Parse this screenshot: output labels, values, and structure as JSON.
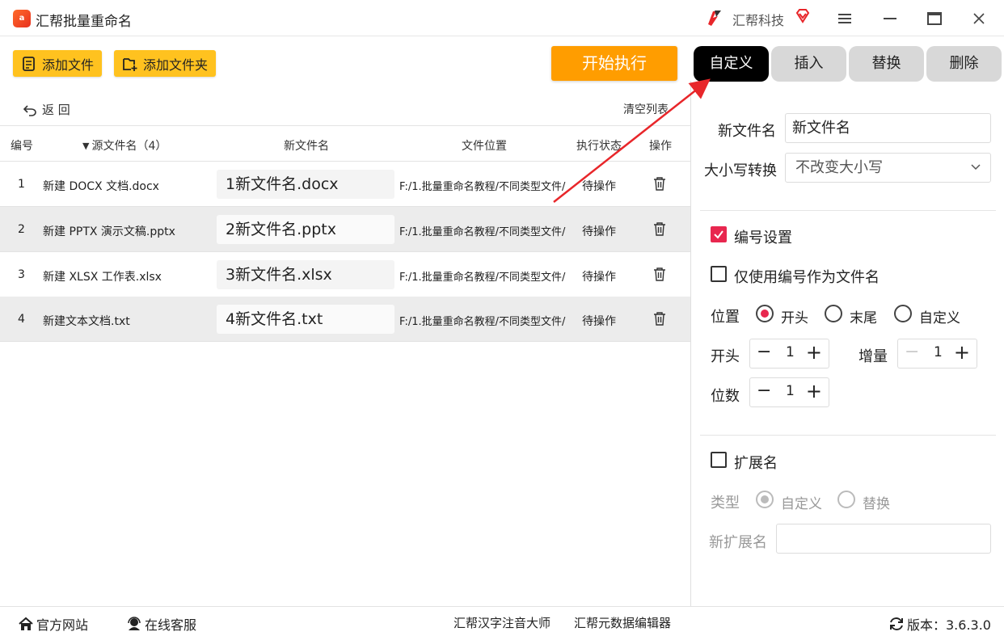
{
  "titlebar": {
    "app_title": "汇帮批量重命名",
    "brand_name": "汇帮科技"
  },
  "toolbar": {
    "add_file": "添加文件",
    "add_folder": "添加文件夹",
    "start": "开始执行"
  },
  "tabs": [
    {
      "label": "自定义",
      "active": true
    },
    {
      "label": "插入",
      "active": false
    },
    {
      "label": "替换",
      "active": false
    },
    {
      "label": "删除",
      "active": false
    }
  ],
  "list": {
    "back_label": "返  回",
    "clear_label": "清空列表",
    "headers": {
      "index": "编号",
      "source": "源文件名（4）",
      "new_name": "新文件名",
      "location": "文件位置",
      "status": "执行状态",
      "action": "操作"
    },
    "rows": [
      {
        "index": "1",
        "source": "新建 DOCX 文档.docx",
        "new_name": "1新文件名.docx",
        "location": "F:/1.批量重命名教程/不同类型文件/",
        "status": "待操作"
      },
      {
        "index": "2",
        "source": "新建 PPTX 演示文稿.pptx",
        "new_name": "2新文件名.pptx",
        "location": "F:/1.批量重命名教程/不同类型文件/",
        "status": "待操作"
      },
      {
        "index": "3",
        "source": "新建 XLSX 工作表.xlsx",
        "new_name": "3新文件名.xlsx",
        "location": "F:/1.批量重命名教程/不同类型文件/",
        "status": "待操作"
      },
      {
        "index": "4",
        "source": "新建文本文档.txt",
        "new_name": "4新文件名.txt",
        "location": "F:/1.批量重命名教程/不同类型文件/",
        "status": "待操作"
      }
    ]
  },
  "panel": {
    "new_name_label": "新文件名",
    "new_name_value": "新文件名",
    "case_label": "大小写转换",
    "case_value": "不改变大小写",
    "numbering_label": "编号设置",
    "numbering_checked": true,
    "only_number_label": "仅使用编号作为文件名",
    "only_number_checked": false,
    "position_label": "位置",
    "position_options": [
      "开头",
      "末尾",
      "自定义"
    ],
    "position_selected": "开头",
    "start_label": "开头",
    "start_value": "1",
    "increment_label": "增量",
    "increment_value": "1",
    "digits_label": "位数",
    "digits_value": "1",
    "ext_label": "扩展名",
    "ext_checked": false,
    "type_label": "类型",
    "type_options": [
      "自定义",
      "替换"
    ],
    "type_selected": "自定义",
    "new_ext_label": "新扩展名",
    "new_ext_value": ""
  },
  "footer": {
    "website": "官方网站",
    "support": "在线客服",
    "pinyin": "汇帮汉字注音大师",
    "metadata": "汇帮元数据编辑器",
    "version": "版本：3.6.3.0"
  },
  "colors": {
    "accent_yellow": "#ffc21f",
    "start_orange": "#ff9d00",
    "check_red": "#e8274f",
    "arrow_red": "#e8262a"
  }
}
